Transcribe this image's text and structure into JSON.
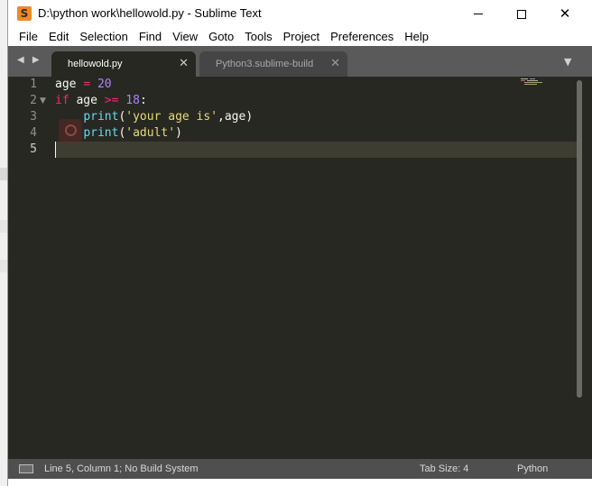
{
  "window": {
    "title": "D:\\python work\\hellowold.py - Sublime Text",
    "icon_glyph": "S",
    "controls": {
      "minimize": "minimize-icon",
      "maximize": "maximize-icon",
      "close": "✕"
    }
  },
  "menu": {
    "items": [
      "File",
      "Edit",
      "Selection",
      "Find",
      "View",
      "Goto",
      "Tools",
      "Project",
      "Preferences",
      "Help"
    ]
  },
  "tabs": {
    "nav": "◀ ▶",
    "items": [
      {
        "label": "hellowold.py",
        "active": true,
        "close": "✕"
      },
      {
        "label": "Python3.sublime-build",
        "active": false,
        "close": "✕"
      }
    ],
    "dropdown": "▼"
  },
  "editor": {
    "line_numbers": [
      "1",
      "2",
      "3",
      "4",
      "5"
    ],
    "fold_marker": "▼",
    "current_line": 5,
    "lines": [
      {
        "indent": "",
        "tokens": [
          {
            "t": "age",
            "c": ""
          },
          {
            "t": " ",
            "c": ""
          },
          {
            "t": "=",
            "c": "kw"
          },
          {
            "t": " ",
            "c": ""
          },
          {
            "t": "20",
            "c": "num"
          }
        ]
      },
      {
        "indent": "",
        "tokens": [
          {
            "t": "if",
            "c": "kw"
          },
          {
            "t": " age ",
            "c": ""
          },
          {
            "t": ">=",
            "c": "kw"
          },
          {
            "t": " ",
            "c": ""
          },
          {
            "t": "18",
            "c": "num"
          },
          {
            "t": ":",
            "c": ""
          }
        ]
      },
      {
        "indent": "    ",
        "tokens": [
          {
            "t": "print",
            "c": "fn"
          },
          {
            "t": "(",
            "c": ""
          },
          {
            "t": "'your age is'",
            "c": "str"
          },
          {
            "t": ",age)",
            "c": ""
          }
        ]
      },
      {
        "indent": "    ",
        "tokens": [
          {
            "t": "print",
            "c": "fn"
          },
          {
            "t": "(",
            "c": ""
          },
          {
            "t": "'adult'",
            "c": "str"
          },
          {
            "t": ")",
            "c": ""
          }
        ]
      },
      {
        "indent": "",
        "tokens": []
      }
    ]
  },
  "colors": {
    "editor_bg": "#272822",
    "keyword": "#f92672",
    "number": "#ae81ff",
    "string": "#e6db74",
    "function": "#66d9ef",
    "text": "#f8f8f2"
  },
  "status": {
    "position": "Line 5, Column 1; No Build System",
    "tab_size": "Tab Size: 4",
    "syntax": "Python"
  }
}
